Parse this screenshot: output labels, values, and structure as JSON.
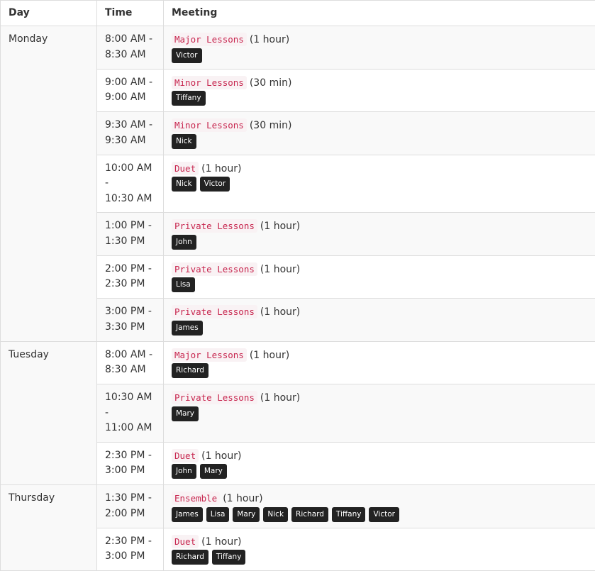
{
  "headers": {
    "day": "Day",
    "time": "Time",
    "meeting": "Meeting"
  },
  "days": [
    {
      "name": "Monday",
      "meetings": [
        {
          "time_start": "8:00 AM -",
          "time_end": "8:30 AM",
          "type": "Major Lessons",
          "duration": "(1 hour)",
          "people": [
            "Victor"
          ]
        },
        {
          "time_start": "9:00 AM -",
          "time_end": "9:00 AM",
          "type": "Minor Lessons",
          "duration": "(30 min)",
          "people": [
            "Tiffany"
          ]
        },
        {
          "time_start": "9:30 AM -",
          "time_end": "9:30 AM",
          "type": "Minor Lessons",
          "duration": "(30 min)",
          "people": [
            "Nick"
          ]
        },
        {
          "time_start": "10:00 AM -",
          "time_end": "10:30 AM",
          "type": "Duet",
          "duration": "(1 hour)",
          "people": [
            "Nick",
            "Victor"
          ]
        },
        {
          "time_start": "1:00 PM -",
          "time_end": "1:30 PM",
          "type": "Private Lessons",
          "duration": "(1 hour)",
          "people": [
            "John"
          ]
        },
        {
          "time_start": "2:00 PM -",
          "time_end": "2:30 PM",
          "type": "Private Lessons",
          "duration": "(1 hour)",
          "people": [
            "Lisa"
          ]
        },
        {
          "time_start": "3:00 PM -",
          "time_end": "3:30 PM",
          "type": "Private Lessons",
          "duration": "(1 hour)",
          "people": [
            "James"
          ]
        }
      ]
    },
    {
      "name": "Tuesday",
      "meetings": [
        {
          "time_start": "8:00 AM -",
          "time_end": "8:30 AM",
          "type": "Major Lessons",
          "duration": "(1 hour)",
          "people": [
            "Richard"
          ]
        },
        {
          "time_start": "10:30 AM -",
          "time_end": "11:00 AM",
          "type": "Private Lessons",
          "duration": "(1 hour)",
          "people": [
            "Mary"
          ]
        },
        {
          "time_start": "2:30 PM -",
          "time_end": "3:00 PM",
          "type": "Duet",
          "duration": "(1 hour)",
          "people": [
            "John",
            "Mary"
          ]
        }
      ]
    },
    {
      "name": "Thursday",
      "meetings": [
        {
          "time_start": "1:30 PM -",
          "time_end": "2:00 PM",
          "type": "Ensemble",
          "duration": "(1 hour)",
          "people": [
            "James",
            "Lisa",
            "Mary",
            "Nick",
            "Richard",
            "Tiffany",
            "Victor"
          ]
        },
        {
          "time_start": "2:30 PM -",
          "time_end": "3:00 PM",
          "type": "Duet",
          "duration": "(1 hour)",
          "people": [
            "Richard",
            "Tiffany"
          ]
        }
      ]
    }
  ]
}
